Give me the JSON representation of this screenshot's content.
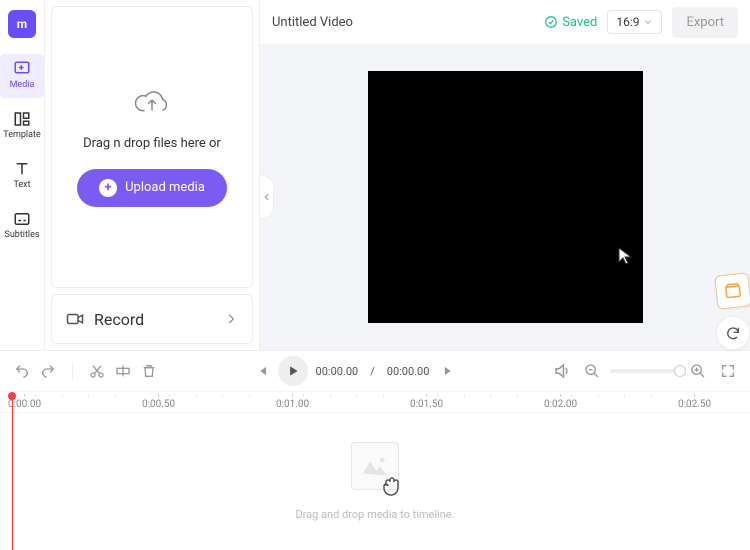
{
  "brand": {
    "glyph": "m"
  },
  "nav": {
    "items": [
      {
        "label": "Media",
        "active": true
      },
      {
        "label": "Template",
        "active": false
      },
      {
        "label": "Text",
        "active": false
      },
      {
        "label": "Subtitles",
        "active": false
      }
    ]
  },
  "media_panel": {
    "drop_text": "Drag n drop files here or",
    "upload_label": "Upload media",
    "record_label": "Record"
  },
  "header": {
    "title": "Untitled Video",
    "saved_label": "Saved",
    "aspect_ratio": "16:9",
    "export_label": "Export"
  },
  "playback": {
    "current_time": "00:00.00",
    "separator": "/",
    "total_time": "00:00.00"
  },
  "ruler": {
    "ticks": [
      "0:00.00",
      "0:00.50",
      "0:01.00",
      "0:01.50",
      "0:02.00",
      "0:02.50"
    ]
  },
  "track_hint": "Drag and drop media to timeline.",
  "colors": {
    "accent": "#7a5cf5",
    "saved": "#1bbf8b",
    "playhead": "#ff3b3b"
  }
}
